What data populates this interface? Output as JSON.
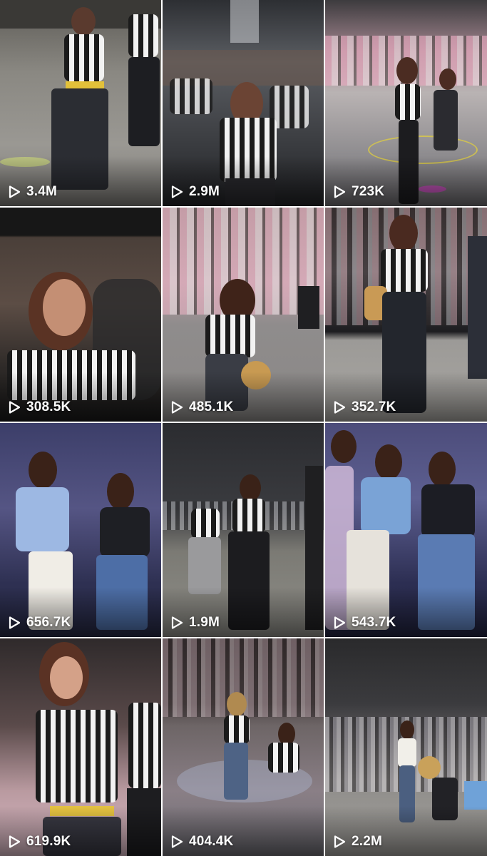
{
  "videos": [
    {
      "views": "3.4M",
      "play_icon": "play-outline-icon"
    },
    {
      "views": "2.9M",
      "play_icon": "play-outline-icon"
    },
    {
      "views": "723K",
      "play_icon": "play-outline-icon"
    },
    {
      "views": "308.5K",
      "play_icon": "play-outline-icon"
    },
    {
      "views": "485.1K",
      "play_icon": "play-outline-icon"
    },
    {
      "views": "352.7K",
      "play_icon": "play-outline-icon"
    },
    {
      "views": "656.7K",
      "play_icon": "play-outline-icon"
    },
    {
      "views": "1.9M",
      "play_icon": "play-outline-icon"
    },
    {
      "views": "543.7K",
      "play_icon": "play-outline-icon"
    },
    {
      "views": "619.9K",
      "play_icon": "play-outline-icon"
    },
    {
      "views": "404.4K",
      "play_icon": "play-outline-icon"
    },
    {
      "views": "2.2M",
      "play_icon": "play-outline-icon"
    }
  ],
  "colors": {
    "count_text": "#ffffff",
    "background": "#ffffff"
  }
}
